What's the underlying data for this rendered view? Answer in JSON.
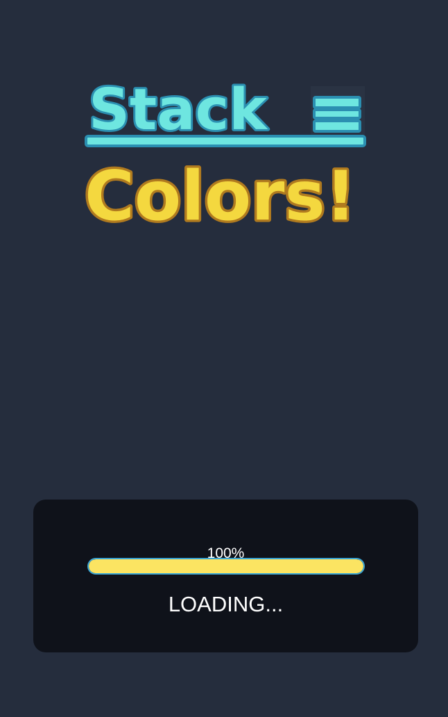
{
  "logo": {
    "line1": "Stack",
    "line2": "Colors!",
    "line1_color": "#6ee6e0",
    "line1_outline": "#2b8fb1",
    "line2_color": "#f4d83f",
    "line2_outline": "#b07a1f"
  },
  "loading": {
    "percent_text": "100%",
    "progress_fraction": 1.0,
    "label": "LOADING...",
    "bar_fill_color": "#fbe462",
    "bar_border_color": "#3aa7d6"
  },
  "colors": {
    "background": "#252d3d",
    "panel": "#0f121a"
  }
}
